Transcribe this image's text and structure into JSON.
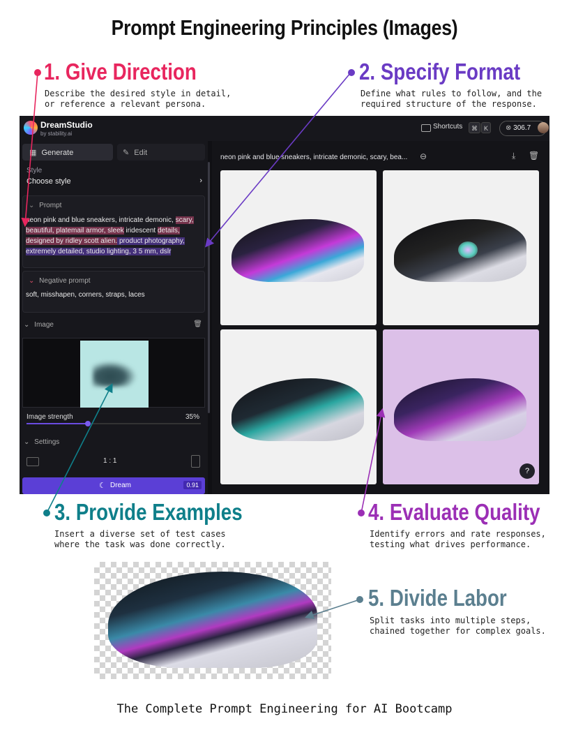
{
  "page_title": "Prompt Engineering Principles (Images)",
  "principles": [
    {
      "title": "1. Give Direction",
      "desc": "Describe the desired style in detail,\nor reference a relevant persona.",
      "color": "#e8265e"
    },
    {
      "title": "2. Specify Format",
      "desc": "Define what rules to follow, and the\nrequired structure of the response.",
      "color": "#6a3bc4"
    },
    {
      "title": "3. Provide Examples",
      "desc": "Insert a diverse set of test cases\nwhere the task was done correctly.",
      "color": "#0f7f8a"
    },
    {
      "title": "4. Evaluate Quality",
      "desc": "Identify errors and rate responses,\ntesting what drives performance.",
      "color": "#9b2fb5"
    },
    {
      "title": "5. Divide Labor",
      "desc": "Split tasks into multiple steps,\nchained together for complex goals.",
      "color": "#5b7f8f"
    }
  ],
  "app": {
    "brand": "DreamStudio",
    "brand_sub": "by stability.ai",
    "shortcuts_label": "Shortcuts",
    "shortcut_keys": [
      "⌘",
      "K"
    ],
    "credits": "306.7",
    "tabs": {
      "generate": "Generate",
      "edit": "Edit"
    },
    "style_label": "Style",
    "style_value": "Choose style",
    "prompt_label": "Prompt",
    "prompt_parts": [
      "neon pink and blue sneakers, intricate demonic,",
      "scary, beautiful, platemail armor, sleek",
      " iridescent",
      "details, designed by ridley scott alien.",
      " product photography, extremely detailed, studio lighting, 3 5 mm, dslr"
    ],
    "negative_label": "Negative prompt",
    "negative_value": "soft, misshapen, corners, straps, laces",
    "image_label": "Image",
    "image_strength_label": "Image strength",
    "image_strength_value": "35%",
    "image_strength": 0.35,
    "settings_label": "Settings",
    "aspect_ratio": "1 : 1",
    "dream_label": "Dream",
    "dream_cost": "0.91",
    "result_prompt": "neon pink and blue sneakers, intricate demonic, scary, bea...",
    "help_label": "?"
  },
  "footer": "The Complete Prompt Engineering for AI Bootcamp"
}
